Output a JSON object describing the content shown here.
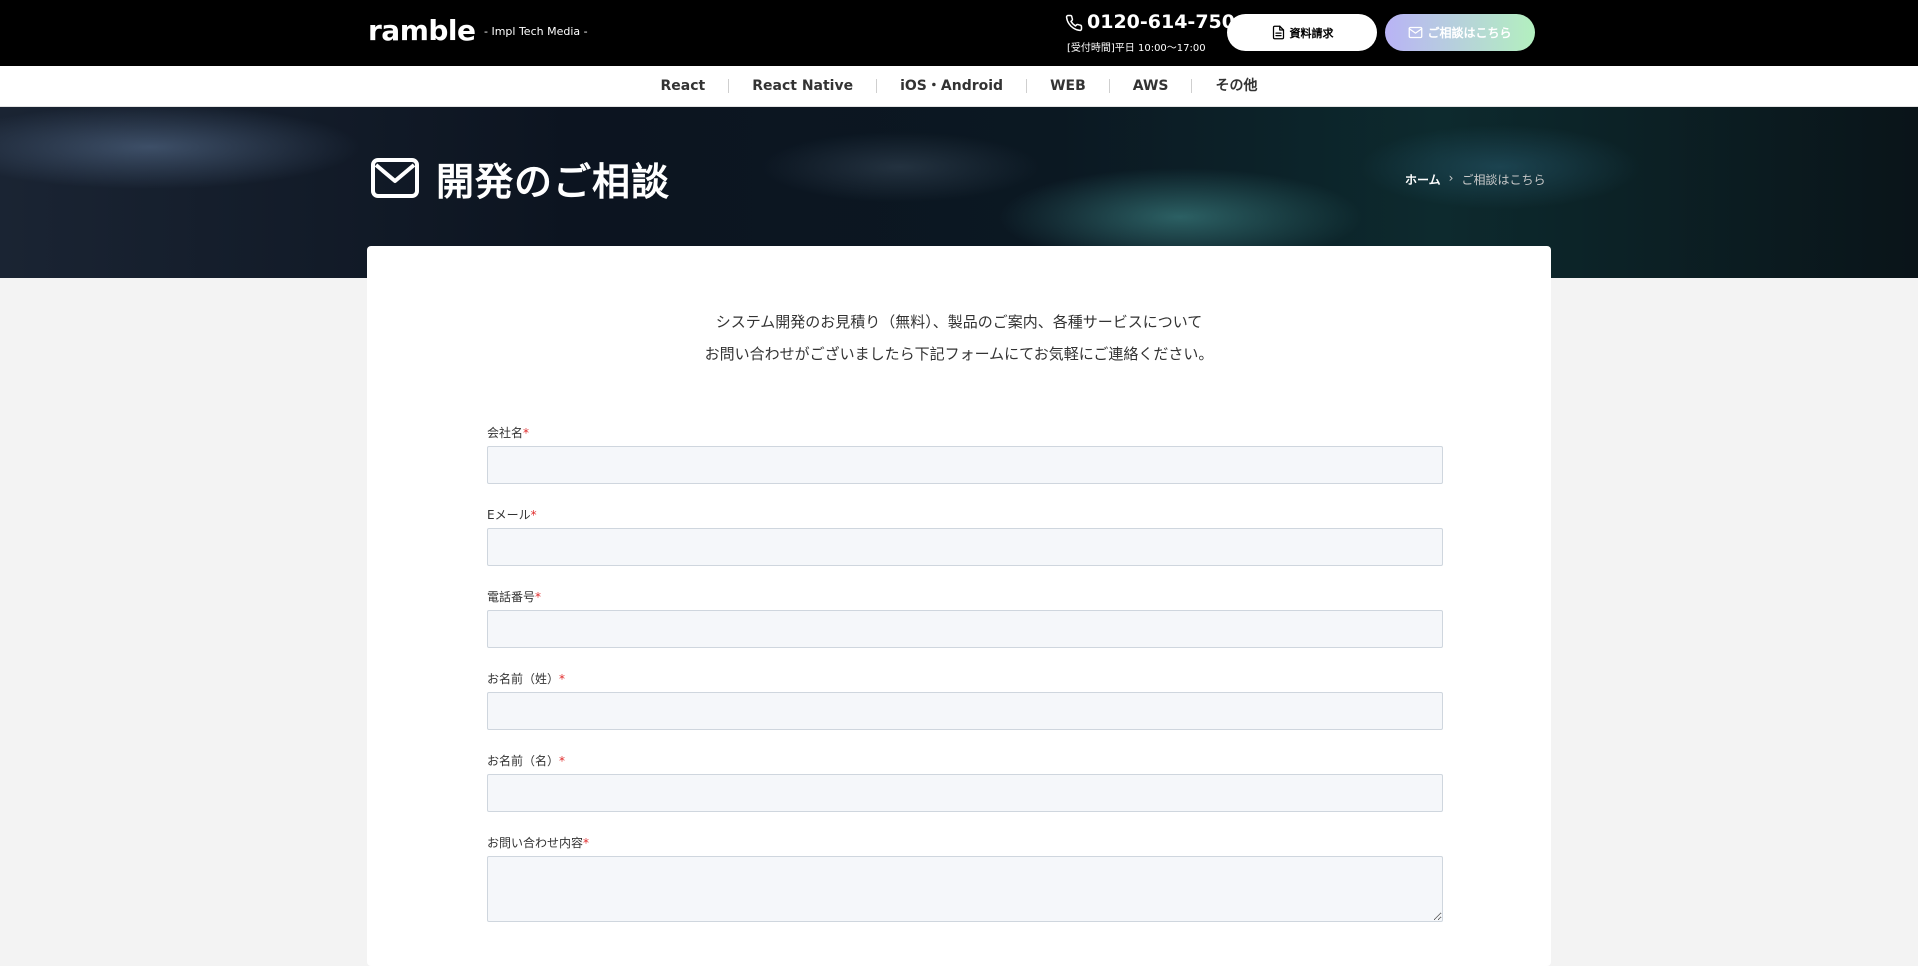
{
  "header": {
    "logo": "ramble",
    "tagline": "- Impl Tech Media -",
    "phone_number": "0120-614-750",
    "phone_hours": "[受付時間]平日 10:00〜17:00",
    "doc_request_label": "資料請求",
    "consult_label": "ご相談はこちら"
  },
  "nav": {
    "items": [
      "React",
      "React Native",
      "iOS・Android",
      "WEB",
      "AWS",
      "その他"
    ]
  },
  "hero": {
    "title": "開発のご相談",
    "breadcrumb_home": "ホーム",
    "breadcrumb_current": "ご相談はこちら"
  },
  "intro": {
    "line1": "システム開発のお見積り（無料）、製品のご案内、各種サービスについて",
    "line2": "お問い合わせがございましたら下記フォームにてお気軽にご連絡ください。"
  },
  "form": {
    "required_mark": "*",
    "fields": [
      {
        "label": "会社名",
        "value": ""
      },
      {
        "label": "Eメール",
        "value": ""
      },
      {
        "label": "電話番号",
        "value": ""
      },
      {
        "label": "お名前（姓）",
        "value": ""
      },
      {
        "label": "お名前（名）",
        "value": ""
      },
      {
        "label": "お問い合わせ内容",
        "value": ""
      }
    ]
  },
  "colors": {
    "header_bg": "#000000",
    "required": "#e02b2b",
    "input_bg": "#f5f7fa",
    "page_bg": "#f3f3f3"
  },
  "icons": {
    "phone": "phone-icon",
    "document": "document-icon",
    "mail": "mail-icon",
    "breadcrumb_separator": "chevron-right-icon"
  }
}
